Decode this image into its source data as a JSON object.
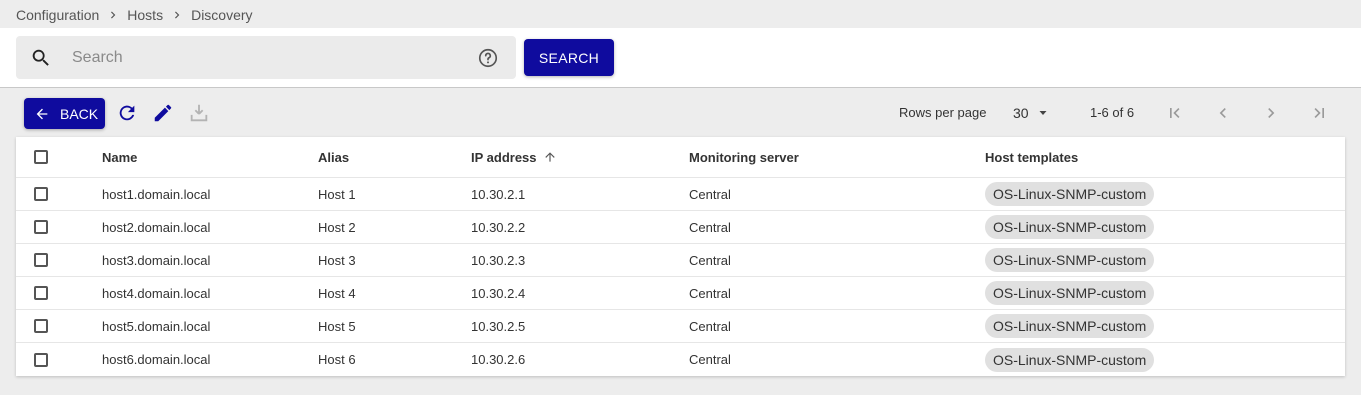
{
  "breadcrumb": {
    "items": [
      "Configuration",
      "Hosts",
      "Discovery"
    ]
  },
  "search": {
    "placeholder": "Search",
    "button_label": "SEARCH"
  },
  "toolbar": {
    "back_label": "BACK"
  },
  "pagination": {
    "rows_per_page_label": "Rows per page",
    "rows_per_page_value": "30",
    "range": "1-6 of 6"
  },
  "colors": {
    "accent": "#0f0b9e",
    "chip": "#e0e0e0"
  },
  "table": {
    "columns": [
      "Name",
      "Alias",
      "IP address",
      "Monitoring server",
      "Host templates"
    ],
    "sorted_column": "IP address",
    "sort_direction": "ascending",
    "rows": [
      {
        "name": "host1.domain.local",
        "alias": "Host 1",
        "ip": "10.30.2.1",
        "server": "Central",
        "template": "OS-Linux-SNMP-custom"
      },
      {
        "name": "host2.domain.local",
        "alias": "Host 2",
        "ip": "10.30.2.2",
        "server": "Central",
        "template": "OS-Linux-SNMP-custom"
      },
      {
        "name": "host3.domain.local",
        "alias": "Host 3",
        "ip": "10.30.2.3",
        "server": "Central",
        "template": "OS-Linux-SNMP-custom"
      },
      {
        "name": "host4.domain.local",
        "alias": "Host 4",
        "ip": "10.30.2.4",
        "server": "Central",
        "template": "OS-Linux-SNMP-custom"
      },
      {
        "name": "host5.domain.local",
        "alias": "Host 5",
        "ip": "10.30.2.5",
        "server": "Central",
        "template": "OS-Linux-SNMP-custom"
      },
      {
        "name": "host6.domain.local",
        "alias": "Host 6",
        "ip": "10.30.2.6",
        "server": "Central",
        "template": "OS-Linux-SNMP-custom"
      }
    ]
  }
}
